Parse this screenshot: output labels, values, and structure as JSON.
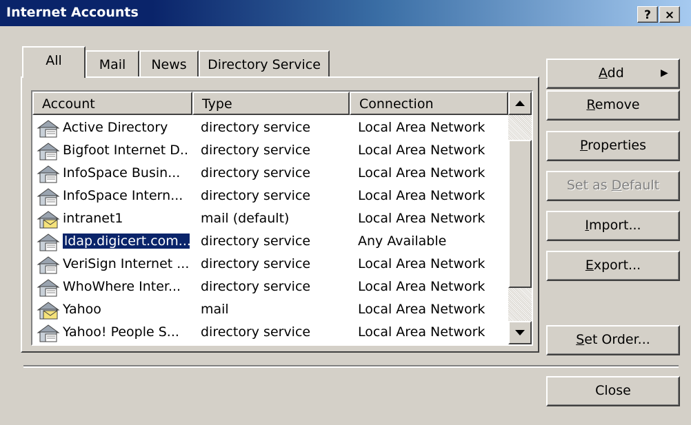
{
  "window": {
    "title": "Internet Accounts",
    "help_label": "?",
    "close_label": "×"
  },
  "tabs": [
    {
      "label": "All",
      "active": true
    },
    {
      "label": "Mail",
      "active": false
    },
    {
      "label": "News",
      "active": false
    },
    {
      "label": "Directory Service",
      "active": false
    }
  ],
  "list": {
    "columns": [
      "Account",
      "Type",
      "Connection"
    ],
    "rows": [
      {
        "account": "Active Directory",
        "type": "directory service",
        "connection": "Local Area Network",
        "icon": "directory-service-icon",
        "selected": false
      },
      {
        "account": "Bigfoot Internet D...",
        "type": "directory service",
        "connection": "Local Area Network",
        "icon": "directory-service-icon",
        "selected": false
      },
      {
        "account": "InfoSpace Busin...",
        "type": "directory service",
        "connection": "Local Area Network",
        "icon": "directory-service-icon",
        "selected": false
      },
      {
        "account": "InfoSpace Intern...",
        "type": "directory service",
        "connection": "Local Area Network",
        "icon": "directory-service-icon",
        "selected": false
      },
      {
        "account": "intranet1",
        "type": "mail (default)",
        "connection": "Local Area Network",
        "icon": "mail-account-icon",
        "selected": false
      },
      {
        "account": "ldap.digicert.com....",
        "type": "directory service",
        "connection": "Any Available",
        "icon": "directory-service-icon",
        "selected": true
      },
      {
        "account": "VeriSign Internet ...",
        "type": "directory service",
        "connection": "Local Area Network",
        "icon": "directory-service-icon",
        "selected": false
      },
      {
        "account": "WhoWhere Inter...",
        "type": "directory service",
        "connection": "Local Area Network",
        "icon": "directory-service-icon",
        "selected": false
      },
      {
        "account": "Yahoo",
        "type": "mail",
        "connection": "Local Area Network",
        "icon": "mail-account-icon",
        "selected": false
      },
      {
        "account": "Yahoo! People S...",
        "type": "directory service",
        "connection": "Local Area Network",
        "icon": "directory-service-icon",
        "selected": false
      }
    ]
  },
  "buttons": {
    "add": {
      "label_pre": "",
      "label_key": "A",
      "label_post": "dd",
      "arrow": "▶"
    },
    "remove": {
      "label_pre": "",
      "label_key": "R",
      "label_post": "emove"
    },
    "properties": {
      "label_pre": "",
      "label_key": "P",
      "label_post": "roperties"
    },
    "set_default": {
      "label_pre": "Set as ",
      "label_key": "D",
      "label_post": "efault",
      "disabled": true
    },
    "import": {
      "label_pre": "",
      "label_key": "I",
      "label_post": "mport..."
    },
    "export": {
      "label_pre": "",
      "label_key": "E",
      "label_post": "xport..."
    },
    "set_order": {
      "label_pre": "",
      "label_key": "S",
      "label_post": "et Order..."
    },
    "close": {
      "label": "Close"
    }
  },
  "colors": {
    "face": "#d4d0c8",
    "title_start": "#0a246a",
    "title_end": "#a6caf0",
    "selection": "#0a246a"
  }
}
